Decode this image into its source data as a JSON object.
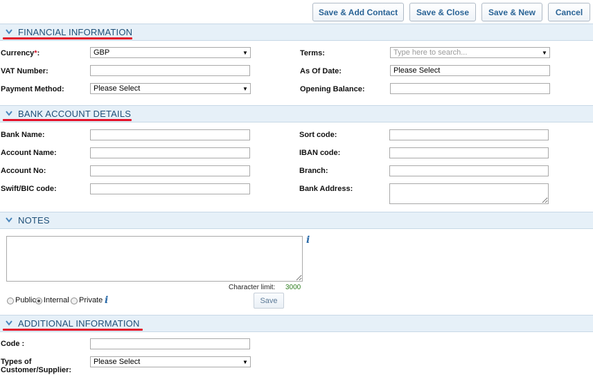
{
  "toolbar": {
    "save_add_contact": "Save & Add Contact",
    "save_close": "Save & Close",
    "save_new": "Save & New",
    "cancel": "Cancel"
  },
  "financial": {
    "title": "FINANCIAL INFORMATION",
    "currency_label": "Currency",
    "currency_required": "*",
    "currency_colon": ":",
    "currency_value": "GBP",
    "vat_label": "VAT Number:",
    "vat_value": "",
    "payment_label": "Payment Method:",
    "payment_value": "Please Select",
    "terms_label": "Terms:",
    "terms_placeholder": "Type here to search...",
    "asof_label": "As Of Date:",
    "asof_value": "Please Select",
    "opening_label": "Opening Balance:",
    "opening_value": ""
  },
  "bank": {
    "title": "BANK ACCOUNT DETAILS",
    "bank_name_label": "Bank Name:",
    "account_name_label": "Account Name:",
    "account_no_label": "Account No:",
    "swift_label": "Swift/BIC code:",
    "sort_label": "Sort code:",
    "iban_label": "IBAN code:",
    "branch_label": "Branch:",
    "address_label": "Bank Address:"
  },
  "notes": {
    "title": "NOTES",
    "char_limit_label": "Character limit:",
    "char_limit_value": "3000",
    "visibility_options": [
      "Public",
      "Internal",
      "Private"
    ],
    "visibility_selected": "Internal",
    "save_label": "Save",
    "info_glyph": "i"
  },
  "additional": {
    "title": "ADDITIONAL INFORMATION",
    "code_label": "Code :",
    "types_label_line1": "Types of",
    "types_label_line2": "Customer/Supplier:",
    "types_value": "Please Select"
  },
  "colors": {
    "accent": "#2a6496",
    "header_bg": "#e6f0f8",
    "header_text": "#1f4f77",
    "underline": "#e3122a",
    "required": "#d3162b",
    "char_limit_value": "#2e7d1f"
  },
  "icons": {
    "section_toggle": "chevron-down-icon",
    "select_arrow": "triangle-down-icon",
    "info": "info-icon"
  }
}
